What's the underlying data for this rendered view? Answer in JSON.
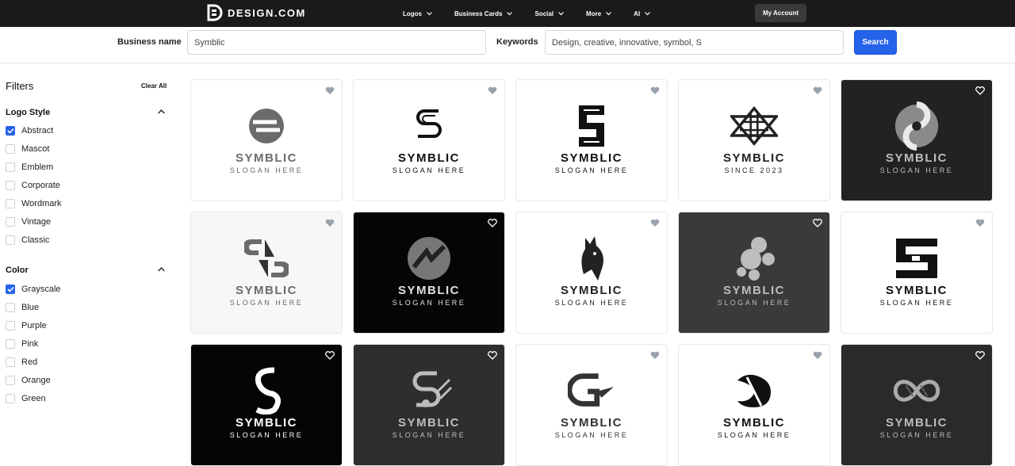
{
  "header": {
    "brand": "DESIGN.COM",
    "nav": [
      {
        "label": "Logos"
      },
      {
        "label": "Business Cards"
      },
      {
        "label": "Social"
      },
      {
        "label": "More"
      },
      {
        "label": "AI"
      }
    ],
    "account_label": "My Account"
  },
  "search": {
    "business_label": "Business name",
    "business_value": "Symblic",
    "keywords_label": "Keywords",
    "keywords_value": "Design, creative, innovative, symbol, S",
    "search_label": "Search"
  },
  "sidebar": {
    "title": "Filters",
    "clear_label": "Clear All",
    "logo_style": {
      "title": "Logo Style",
      "options": [
        {
          "label": "Abstract",
          "checked": true
        },
        {
          "label": "Mascot",
          "checked": false
        },
        {
          "label": "Emblem",
          "checked": false
        },
        {
          "label": "Corporate",
          "checked": false
        },
        {
          "label": "Wordmark",
          "checked": false
        },
        {
          "label": "Vintage",
          "checked": false
        },
        {
          "label": "Classic",
          "checked": false
        }
      ]
    },
    "color": {
      "title": "Color",
      "options": [
        {
          "label": "Grayscale",
          "checked": true
        },
        {
          "label": "Blue",
          "checked": false
        },
        {
          "label": "Purple",
          "checked": false
        },
        {
          "label": "Pink",
          "checked": false
        },
        {
          "label": "Red",
          "checked": false
        },
        {
          "label": "Orange",
          "checked": false
        },
        {
          "label": "Green",
          "checked": false
        }
      ]
    }
  },
  "colors": {
    "accent": "#2563eb",
    "nav_bg": "#1a1a1a"
  },
  "cards": [
    {
      "bg": "#ffffff",
      "fg": "#6b6b6b",
      "name": "SYMBLIC",
      "slogan": "SLOGAN HERE",
      "icon": "s-circle-icon"
    },
    {
      "bg": "#ffffff",
      "fg": "#111111",
      "name": "SYMBLIC",
      "slogan": "SLOGAN HERE",
      "icon": "s-line-icon"
    },
    {
      "bg": "#ffffff",
      "fg": "#111111",
      "name": "SYMBLIC",
      "slogan": "SLOGAN HERE",
      "icon": "s-maze-icon"
    },
    {
      "bg": "#ffffff",
      "fg": "#222222",
      "name": "SYMBLIC",
      "slogan": "SINCE 2023",
      "icon": "hexagram-icon"
    },
    {
      "bg": "#222222",
      "fg": "#bdbdbd",
      "name": "SYMBLIC",
      "slogan": "SLOGAN HERE",
      "icon": "swirl-icon"
    },
    {
      "bg": "#f7f7f7",
      "fg": "#6b6b6b",
      "name": "SYMBLIC",
      "slogan": "SLOGAN HERE",
      "icon": "s-split-icon"
    },
    {
      "bg": "#050505",
      "fg": "#e0e0e0",
      "name": "SYMBLIC",
      "slogan": "SLOGAN HERE",
      "icon": "s-sphere-icon"
    },
    {
      "bg": "#ffffff",
      "fg": "#222222",
      "name": "SYMBLIC",
      "slogan": "SLOGAN HERE",
      "icon": "horse-icon"
    },
    {
      "bg": "#3a3a3a",
      "fg": "#bdbdbd",
      "name": "SYMBLIC",
      "slogan": "SLOGAN HERE",
      "icon": "s-bubbles-icon"
    },
    {
      "bg": "#ffffff",
      "fg": "#111111",
      "name": "SYMBLIC",
      "slogan": "SLOGAN HERE",
      "icon": "s-block-icon"
    },
    {
      "bg": "#050505",
      "fg": "#ffffff",
      "name": "SYMBLIC",
      "slogan": "SLOGAN HERE",
      "icon": "s-ribbon-icon"
    },
    {
      "bg": "#2e2e2e",
      "fg": "#bdbdbd",
      "name": "SYMBLIC",
      "slogan": "SLOGAN HERE",
      "icon": "s-speed-icon"
    },
    {
      "bg": "#ffffff",
      "fg": "#333333",
      "name": "SYMBLIC",
      "slogan": "SLOGAN HERE",
      "icon": "g-arrow-icon"
    },
    {
      "bg": "#ffffff",
      "fg": "#111111",
      "name": "SYMBLIC",
      "slogan": "SLOGAN HERE",
      "icon": "s-twist-icon"
    },
    {
      "bg": "#2a2a2a",
      "fg": "#bdbdbd",
      "name": "SYMBLIC",
      "slogan": "SLOGAN HERE",
      "icon": "infinity-icon"
    }
  ]
}
